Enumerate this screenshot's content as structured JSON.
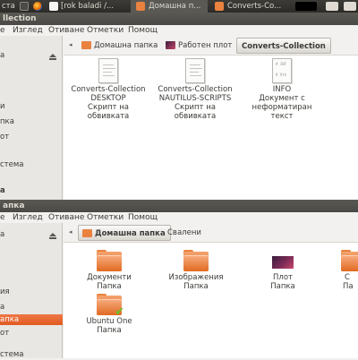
{
  "top_panel": {
    "item0": "ста",
    "tab1": "[rok baladi /...",
    "tab2": "Домашна п...",
    "tab3": "Converts-Co...",
    "colors": {
      "bg": "#3c3b37",
      "active_tab": "#5a5954"
    }
  },
  "window1": {
    "title": "llection",
    "menu": [
      "е",
      "Изглед",
      "Отиване",
      "Отметки",
      "Помощ"
    ],
    "sidebar": [
      "а",
      "",
      "и",
      "пка",
      "от",
      "",
      "стема",
      "",
      "а"
    ],
    "breadcrumbs": [
      {
        "label": "Домашна папка",
        "icon": "home-folder-icon"
      },
      {
        "label": "Работен плот",
        "icon": "desktop-icon"
      },
      {
        "label": "Converts-Collection",
        "icon": ""
      }
    ],
    "files": [
      {
        "name1": "Converts-Collection",
        "name2": "DESKTOP",
        "type1": "Скрипт на",
        "type2": "обвивката",
        "icon": "script-file-icon"
      },
      {
        "name1": "Converts-Collection",
        "name2": "NAUTILUS-SCRIPTS",
        "type1": "Скрипт на",
        "type2": "обвивката",
        "icon": "script-file-icon"
      },
      {
        "name1": "INFO",
        "name2": "Документ с",
        "type1": "неформатиран",
        "type2": "текст",
        "icon": "text-file-icon",
        "tag": "# INF\n\n# 9th"
      }
    ]
  },
  "window2": {
    "title": "апка",
    "menu": [
      "е",
      "Изглед",
      "Отиване",
      "Отметки",
      "Помощ"
    ],
    "sidebar": [
      "а",
      "",
      "ия",
      "а",
      "апка",
      "от",
      "",
      "стема"
    ],
    "selected_sidebar_index": 4,
    "breadcrumbs": [
      {
        "label": "Домашна папка",
        "icon": "home-folder-icon"
      },
      {
        "label": "Свалени",
        "icon": ""
      }
    ],
    "folders": [
      {
        "name": "Документи",
        "type": "Папка",
        "icon": "documents-folder-icon"
      },
      {
        "name": "Изображения",
        "type": "Папка",
        "icon": "pictures-folder-icon"
      },
      {
        "name": "Плот",
        "type": "Папка",
        "icon": "desktop-folder-icon"
      },
      {
        "name": "С",
        "type": "Па",
        "icon": "folder-icon"
      },
      {
        "name": "Ubuntu One",
        "type": "Папка",
        "icon": "ubuntu-one-folder-icon"
      }
    ]
  }
}
